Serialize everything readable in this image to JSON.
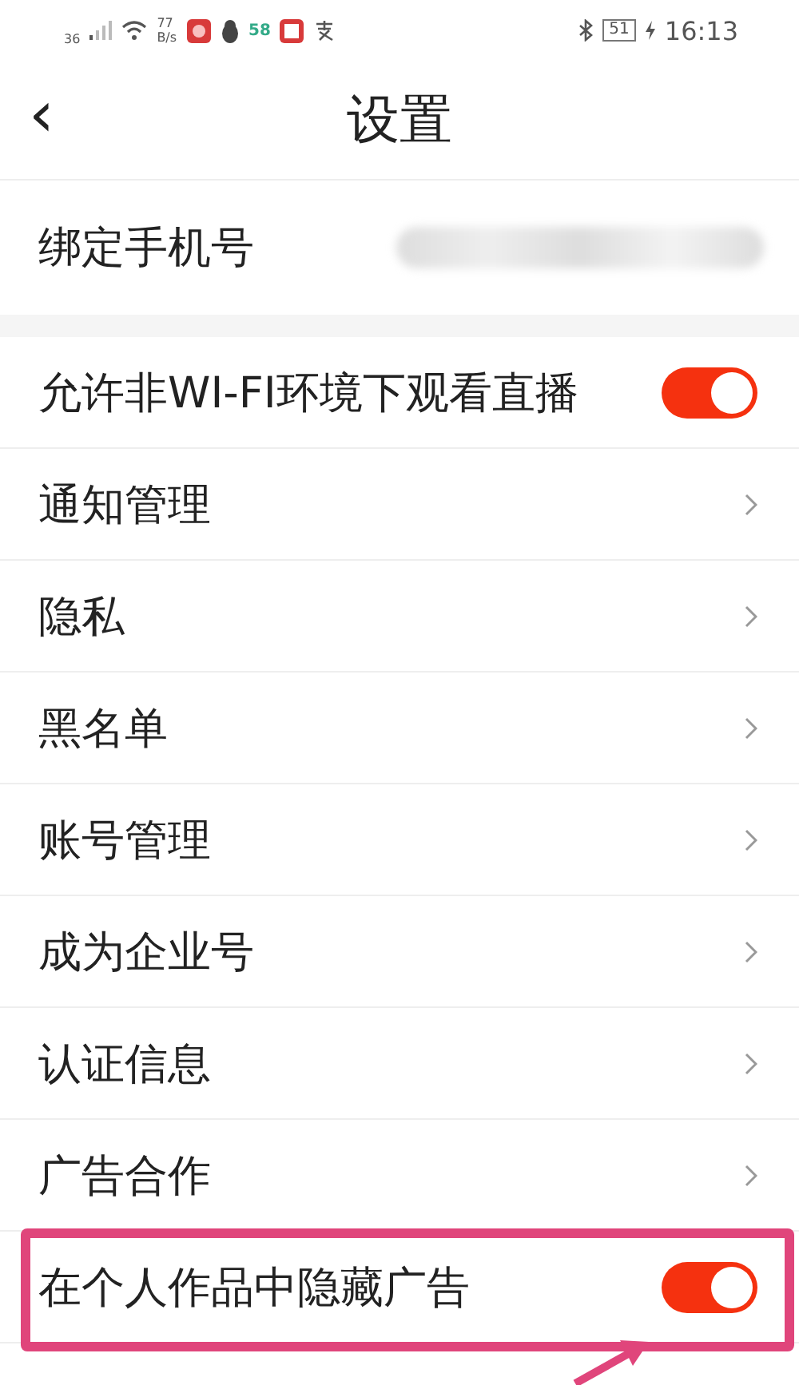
{
  "status_bar": {
    "network": "36",
    "speed": "77",
    "speed_unit": "B/s",
    "app_badge": "58",
    "battery": "51",
    "time": "16:13"
  },
  "header": {
    "back": "‹",
    "title": "设置"
  },
  "phone_row": {
    "label": "绑定手机号"
  },
  "rows": [
    {
      "kind": "toggle",
      "label": "允许非WI-FI环境下观看直播",
      "on": true,
      "highlighted": false
    },
    {
      "kind": "link",
      "label": "通知管理",
      "highlighted": false
    },
    {
      "kind": "link",
      "label": "隐私",
      "highlighted": false
    },
    {
      "kind": "link",
      "label": "黑名单",
      "highlighted": false
    },
    {
      "kind": "link",
      "label": "账号管理",
      "highlighted": false
    },
    {
      "kind": "link",
      "label": "成为企业号",
      "highlighted": false
    },
    {
      "kind": "link",
      "label": "认证信息",
      "highlighted": false
    },
    {
      "kind": "link",
      "label": "广告合作",
      "highlighted": false
    },
    {
      "kind": "toggle",
      "label": "在个人作品中隐藏广告",
      "on": true,
      "highlighted": true
    }
  ]
}
